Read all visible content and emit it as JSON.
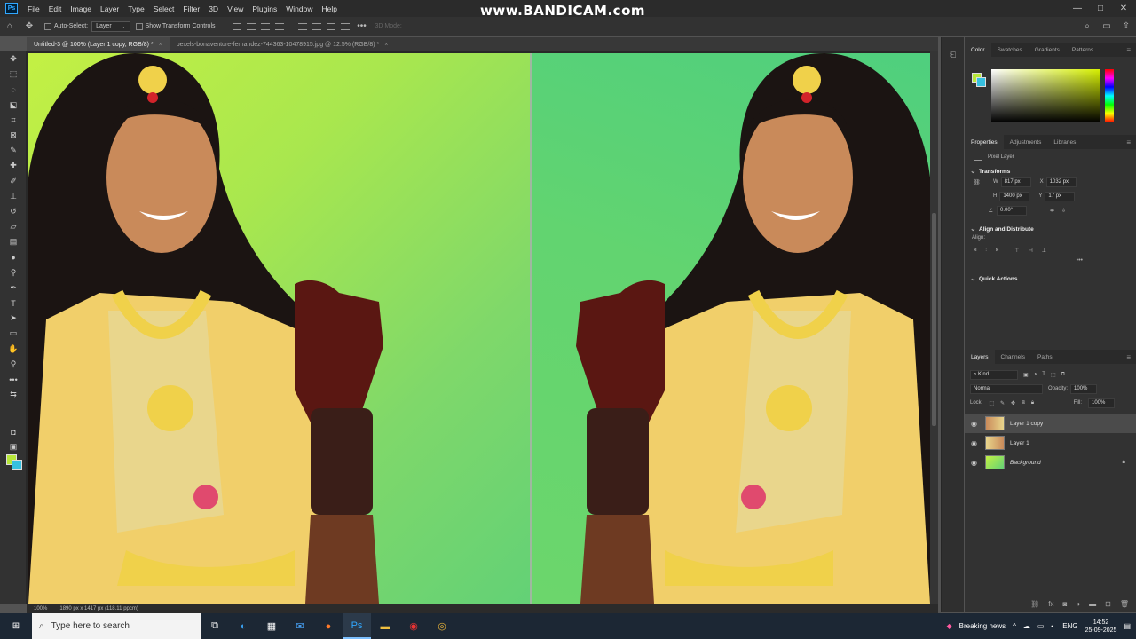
{
  "app": {
    "logo_text": "Ps",
    "watermark": "www.BANDICAM.com"
  },
  "menu": [
    "File",
    "Edit",
    "Image",
    "Layer",
    "Type",
    "Select",
    "Filter",
    "3D",
    "View",
    "Plugins",
    "Window",
    "Help"
  ],
  "options_bar": {
    "auto_select_label": "Auto-Select:",
    "auto_select_value": "Layer",
    "show_transform_label": "Show Transform Controls",
    "mode_3d_label": "3D Mode:"
  },
  "tabs": [
    {
      "label": "Untitled-3 @ 100% (Layer 1 copy, RGB/8) *",
      "active": true
    },
    {
      "label": "pexels-bonaventure-fernandez-744363-10478915.jpg @ 12.5% (RGB/8) *",
      "active": false
    }
  ],
  "status": {
    "zoom": "100%",
    "doc_size": "1890 px x 1417 px (118.11 ppcm)"
  },
  "color_panel": {
    "tabs": [
      "Color",
      "Swatches",
      "Gradients",
      "Patterns"
    ],
    "fg": "#b7e73a",
    "bg": "#36c0e0"
  },
  "properties": {
    "tabs": [
      "Properties",
      "Adjustments",
      "Libraries"
    ],
    "kind": "Pixel Layer",
    "transform_title": "Transforms",
    "w_label": "W",
    "w": "817 px",
    "x_label": "X",
    "x": "1032 px",
    "h_label": "H",
    "h": "1400 px",
    "y_label": "Y",
    "y": "17 px",
    "angle": "0.00°",
    "align_title": "Align and Distribute",
    "align_label": "Align:",
    "quick_title": "Quick Actions"
  },
  "layers_panel": {
    "tabs": [
      "Layers",
      "Channels",
      "Paths"
    ],
    "filter": "Kind",
    "blend": "Normal",
    "opacity_label": "Opacity:",
    "opacity": "100%",
    "lock_label": "Lock:",
    "fill_label": "Fill:",
    "fill": "100%",
    "layers": [
      {
        "name": "Layer 1 copy",
        "selected": true
      },
      {
        "name": "Layer 1",
        "selected": false
      },
      {
        "name": "Background",
        "selected": false
      }
    ]
  },
  "taskbar": {
    "search_placeholder": "Type here to search",
    "news": "Breaking news",
    "lang": "ENG",
    "time": "14:52",
    "date": "25-09-2025"
  }
}
